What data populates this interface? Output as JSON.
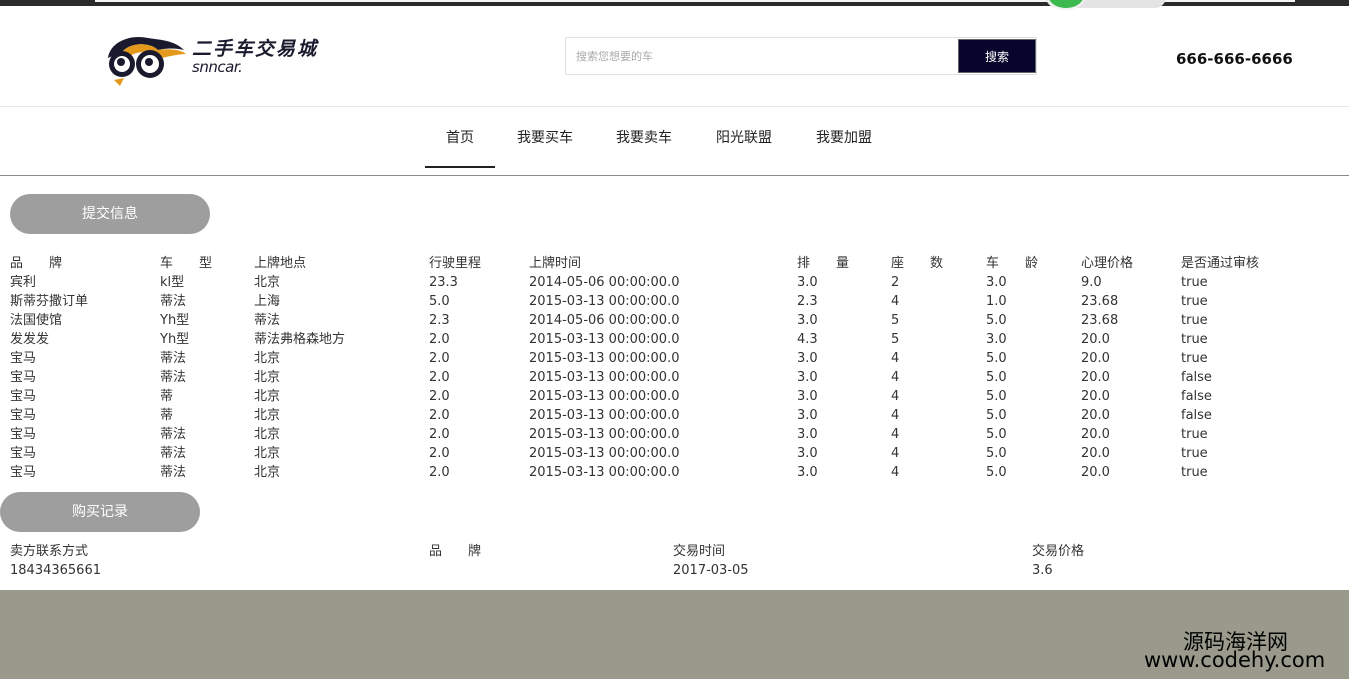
{
  "header": {
    "logo_cn": "二手车交易城",
    "logo_en": "snncar.",
    "search_placeholder": "搜索您想要的车",
    "search_button": "搜索",
    "phone": "666-666-6666"
  },
  "nav": {
    "items": [
      {
        "label": "首页",
        "active": true
      },
      {
        "label": "我要买车",
        "active": false
      },
      {
        "label": "我要卖车",
        "active": false
      },
      {
        "label": "阳光联盟",
        "active": false
      },
      {
        "label": "我要加盟",
        "active": false
      }
    ]
  },
  "submit_section": {
    "button": "提交信息",
    "headers": [
      "品　　牌",
      "车　　型",
      "上牌地点",
      "行驶里程",
      "上牌时间",
      "排　　量",
      "座　　数",
      "车　　龄",
      "心理价格",
      "是否通过审核"
    ],
    "rows": [
      [
        "宾利",
        "kl型",
        "北京",
        "23.3",
        "2014-05-06 00:00:00.0",
        "3.0",
        "2",
        "3.0",
        "9.0",
        "true"
      ],
      [
        "斯蒂芬撒订单",
        "蒂法",
        "上海",
        "5.0",
        "2015-03-13 00:00:00.0",
        "2.3",
        "4",
        "1.0",
        "23.68",
        "true"
      ],
      [
        "法国使馆",
        "Yh型",
        "蒂法",
        "2.3",
        "2014-05-06 00:00:00.0",
        "3.0",
        "5",
        "5.0",
        "23.68",
        "true"
      ],
      [
        "发发发",
        "Yh型",
        "蒂法弗格森地方",
        "2.0",
        "2015-03-13 00:00:00.0",
        "4.3",
        "5",
        "3.0",
        "20.0",
        "true"
      ],
      [
        "宝马",
        "蒂法",
        "北京",
        "2.0",
        "2015-03-13 00:00:00.0",
        "3.0",
        "4",
        "5.0",
        "20.0",
        "true"
      ],
      [
        "宝马",
        "蒂法",
        "北京",
        "2.0",
        "2015-03-13 00:00:00.0",
        "3.0",
        "4",
        "5.0",
        "20.0",
        "false"
      ],
      [
        "宝马",
        "蒂",
        "北京",
        "2.0",
        "2015-03-13 00:00:00.0",
        "3.0",
        "4",
        "5.0",
        "20.0",
        "false"
      ],
      [
        "宝马",
        "蒂",
        "北京",
        "2.0",
        "2015-03-13 00:00:00.0",
        "3.0",
        "4",
        "5.0",
        "20.0",
        "false"
      ],
      [
        "宝马",
        "蒂法",
        "北京",
        "2.0",
        "2015-03-13 00:00:00.0",
        "3.0",
        "4",
        "5.0",
        "20.0",
        "true"
      ],
      [
        "宝马",
        "蒂法",
        "北京",
        "2.0",
        "2015-03-13 00:00:00.0",
        "3.0",
        "4",
        "5.0",
        "20.0",
        "true"
      ],
      [
        "宝马",
        "蒂法",
        "北京",
        "2.0",
        "2015-03-13 00:00:00.0",
        "3.0",
        "4",
        "5.0",
        "20.0",
        "true"
      ]
    ]
  },
  "purchase_section": {
    "button": "购买记录",
    "headers": [
      "卖方联系方式",
      "品　　牌",
      "交易时间",
      "交易价格"
    ],
    "rows": [
      [
        "18434365661",
        "",
        "2017-03-05",
        "3.6"
      ]
    ]
  },
  "watermark": {
    "line1": "源码海洋网",
    "line2": "www.codehy.com"
  },
  "colors": {
    "search_button_bg": "#07052c",
    "pill_bg": "#9e9e9e",
    "footer_bg": "#9a9a8c",
    "logo_accent": "#e39a1c"
  }
}
